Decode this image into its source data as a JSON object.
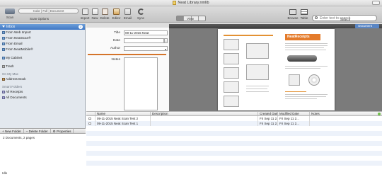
{
  "window": {
    "title": "Neat Library.nmlib"
  },
  "toolbar": {
    "scan_label": "Scan",
    "scan_options_value": "Color | Full | Document",
    "scan_options_label": "Scan Options",
    "import_label": "Import",
    "new_label": "New",
    "delete_label": "Delete",
    "editor_label": "Editor",
    "email_label": "Email",
    "sync_label": "Sync",
    "view_label": "View",
    "browse_label": "Browse",
    "table_label": "Table",
    "search_placeholder": "Enter text to search",
    "search_label": "Search"
  },
  "sidebar": {
    "inbox_label": "Inbox",
    "inbox_count": "2",
    "inbox_items": [
      {
        "label": "From Web Import"
      },
      {
        "label": "From NeatScan®"
      },
      {
        "label": "From Email"
      },
      {
        "label": "From NeatMobile®"
      }
    ],
    "cabinet_label": "My Cabinet",
    "trash_label": "Trash",
    "on_my_mac_label": "On My Mac",
    "address_book_label": "Address Book",
    "smart_folders_label": "Smart Folders",
    "smart_items": [
      {
        "label": "All Receipts"
      },
      {
        "label": "All Documents"
      }
    ],
    "new_folder_label": "+ New Folder",
    "delete_folder_label": "– Delete Folder",
    "properties_label": "⚙ Properties",
    "status": "2 Documents, 2 pages",
    "footer": "Idle"
  },
  "details": {
    "title_label": "Title",
    "title_value": "09-11-2015 Neat",
    "date_label": "Date",
    "date_value": "",
    "author_label": "Author",
    "author_value": "",
    "notes_label": "Notes"
  },
  "viewer": {
    "document_button": "Document",
    "brand_text": "NeatReceipts"
  },
  "list": {
    "columns": [
      "Name",
      "Description",
      "Created Date",
      "Modified Date",
      "Notes"
    ],
    "rows": [
      {
        "name": "09-11-2015 Neat Scan Test 2",
        "description": "",
        "created": "Fri Sep 11 2...",
        "modified": "Fri Sep 11 2...",
        "notes": ""
      },
      {
        "name": "09-11-2015 Neat Scan Test 1",
        "description": "",
        "created": "Fri Sep 11 2...",
        "modified": "Fri Sep 11 2...",
        "notes": ""
      }
    ]
  }
}
